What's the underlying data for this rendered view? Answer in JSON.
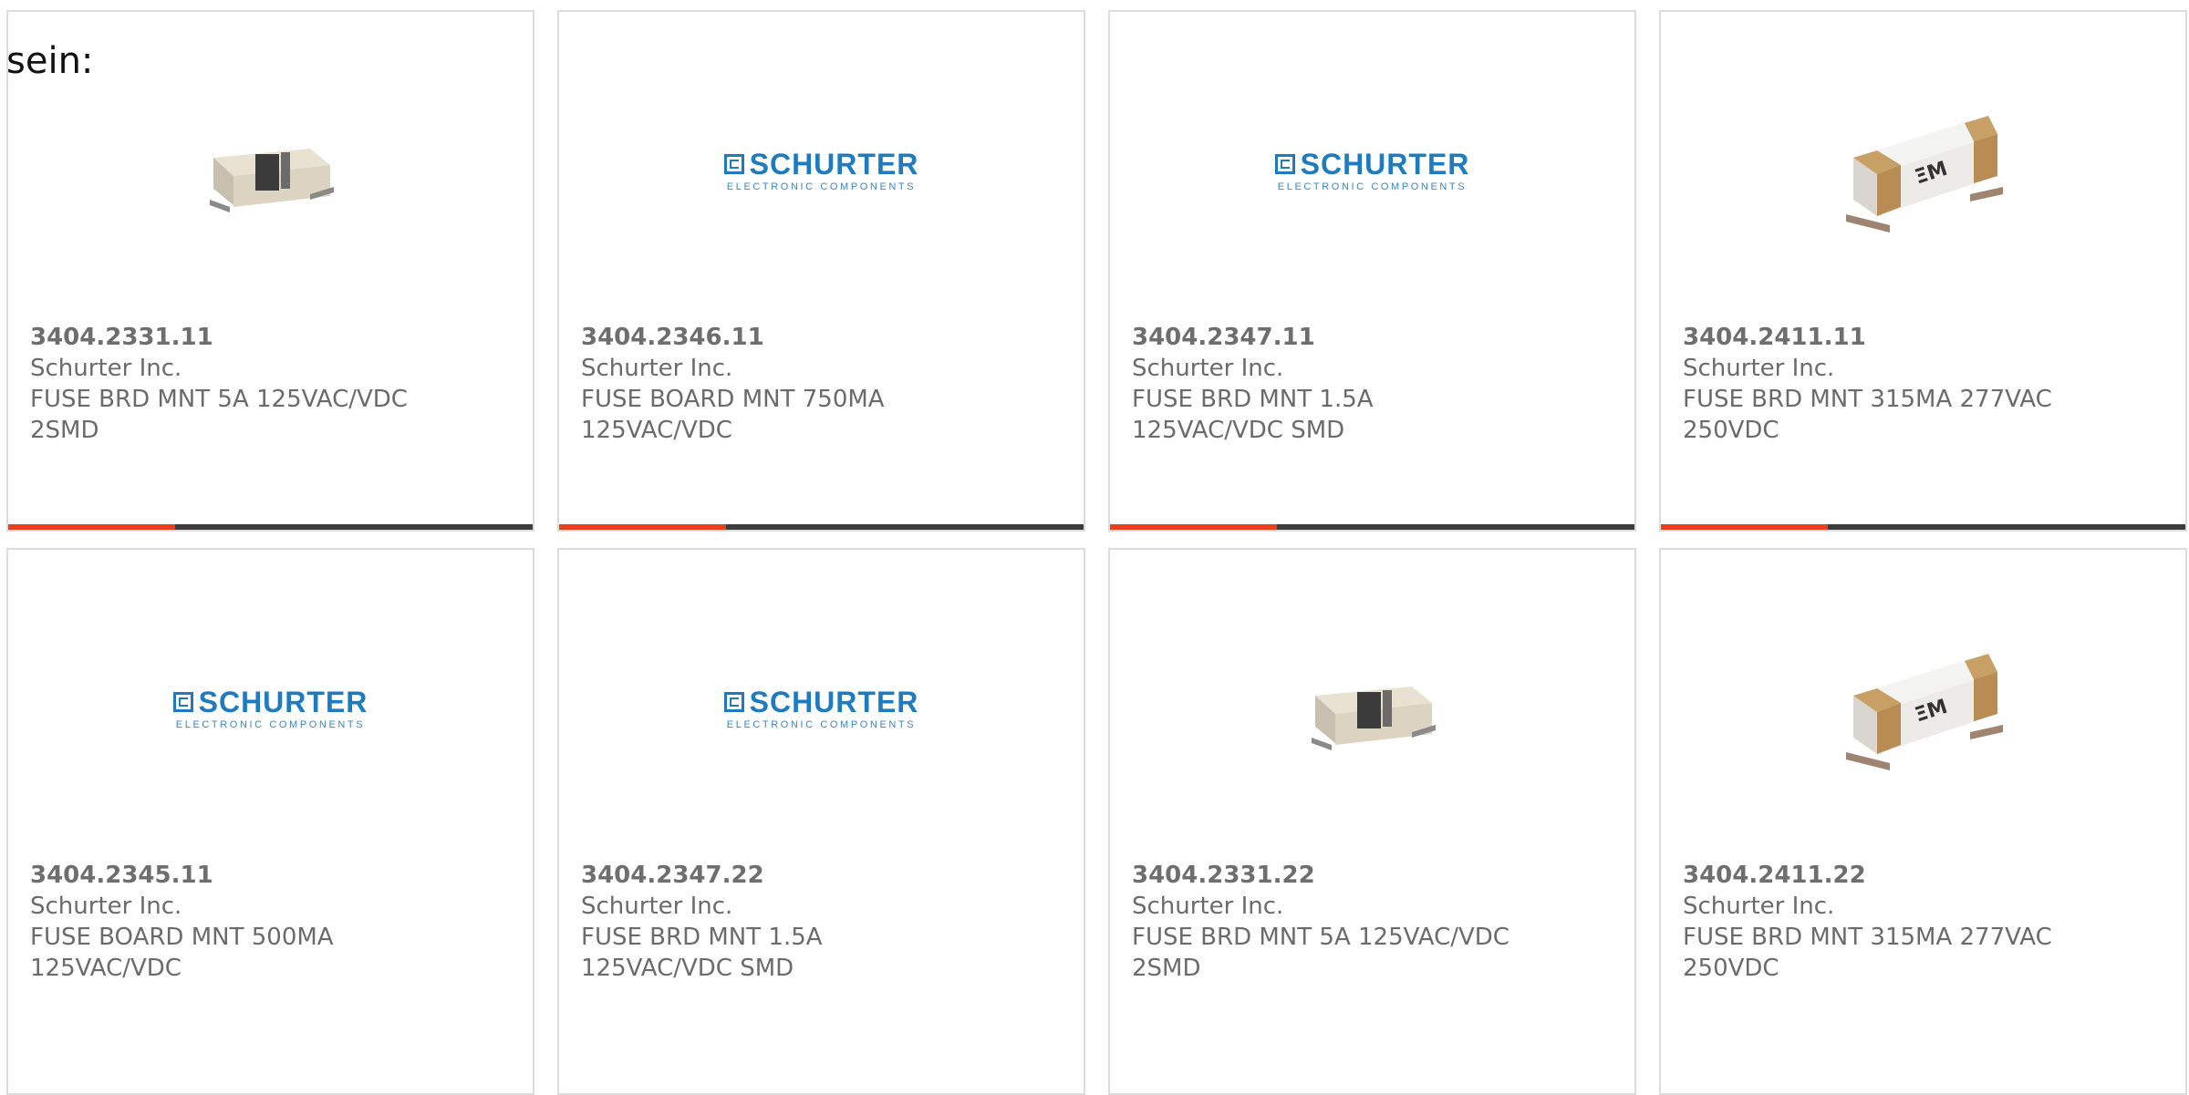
{
  "intro_text": "sein:",
  "logo": {
    "word": "SCHURTER",
    "subtitle": "ELECTRONIC COMPONENTS"
  },
  "colors": {
    "accent": "#e8401c",
    "track": "#3d3d3d",
    "brand_blue": "#1f7bc0"
  },
  "products": [
    {
      "part": "3404.2331.11",
      "mfr": "Schurter Inc.",
      "desc1": "FUSE BRD MNT 5A 125VAC/VDC",
      "desc2": "2SMD",
      "image": "fuse-holder-image",
      "progress": 0.32
    },
    {
      "part": "3404.2346.11",
      "mfr": "Schurter Inc.",
      "desc1": "FUSE BOARD MNT 750MA",
      "desc2": "125VAC/VDC",
      "image": "schurter-logo",
      "progress": 0.32
    },
    {
      "part": "3404.2347.11",
      "mfr": "Schurter Inc.",
      "desc1": "FUSE BRD MNT 1.5A",
      "desc2": "125VAC/VDC SMD",
      "image": "schurter-logo",
      "progress": 0.32
    },
    {
      "part": "3404.2411.11",
      "mfr": "Schurter Inc.",
      "desc1": "FUSE BRD MNT 315MA 277VAC",
      "desc2": "250VDC",
      "image": "smd-fuse-image",
      "progress": 0.32
    },
    {
      "part": "3404.2345.11",
      "mfr": "Schurter Inc.",
      "desc1": "FUSE BOARD MNT 500MA",
      "desc2": "125VAC/VDC",
      "image": "schurter-logo"
    },
    {
      "part": "3404.2347.22",
      "mfr": "Schurter Inc.",
      "desc1": "FUSE BRD MNT 1.5A",
      "desc2": "125VAC/VDC SMD",
      "image": "schurter-logo"
    },
    {
      "part": "3404.2331.22",
      "mfr": "Schurter Inc.",
      "desc1": "FUSE BRD MNT 5A 125VAC/VDC",
      "desc2": "2SMD",
      "image": "fuse-holder-image"
    },
    {
      "part": "3404.2411.22",
      "mfr": "Schurter Inc.",
      "desc1": "FUSE BRD MNT 315MA 277VAC",
      "desc2": "250VDC",
      "image": "smd-fuse-image"
    }
  ]
}
